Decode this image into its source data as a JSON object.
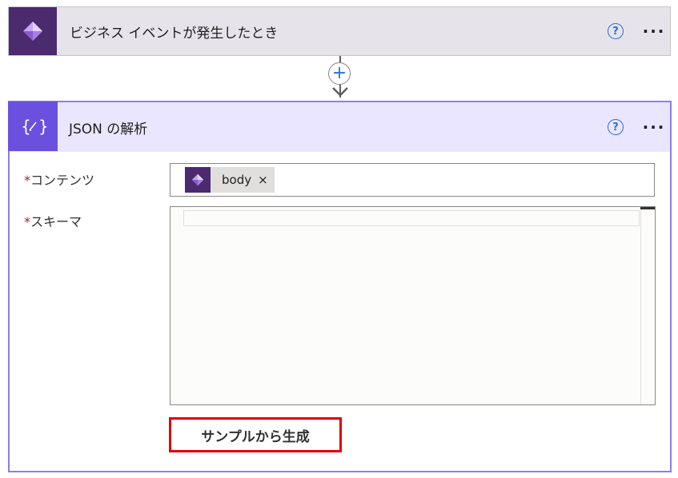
{
  "trigger": {
    "title": "ビジネス イベントが発生したとき",
    "icon": "dataverse-diamond-icon",
    "help": "?",
    "more": "···"
  },
  "connector": {
    "add": "+"
  },
  "action": {
    "title": "JSON の解析",
    "icon": "json-braces-icon",
    "help": "?",
    "more": "···",
    "fields": {
      "content": {
        "required_mark": "*",
        "label": "コンテンツ",
        "token": {
          "label": "body",
          "close": "×",
          "icon": "dataverse-diamond-icon"
        }
      },
      "schema": {
        "required_mark": "*",
        "label": "スキーマ",
        "value": ""
      }
    },
    "generate_button": "サンプルから生成"
  },
  "colors": {
    "trigger_icon_bg": "#4b2a6e",
    "action_icon_bg": "#6b50e0",
    "action_border": "#8f7cf0",
    "highlight_border": "#e00000",
    "help_blue": "#2b6fd6"
  }
}
